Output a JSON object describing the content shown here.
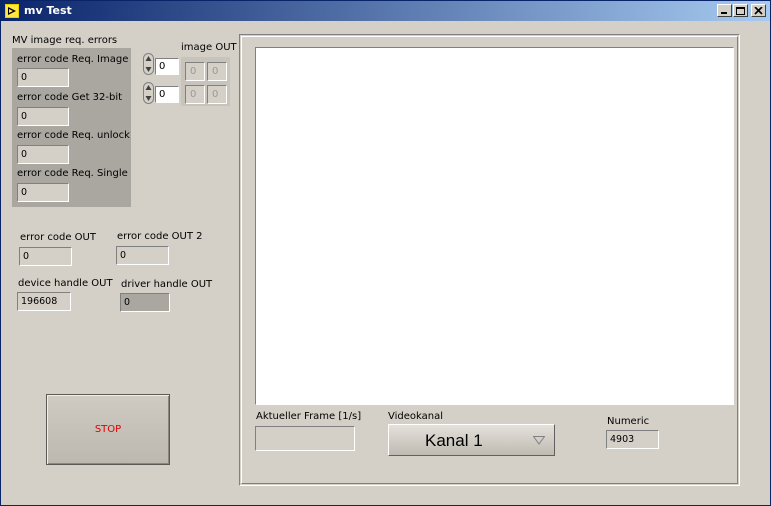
{
  "window": {
    "title": "mv Test",
    "controls": [
      "minimize-icon",
      "maximize-icon",
      "close-icon"
    ]
  },
  "errors_cluster": {
    "title": "MV image req. errors",
    "items": [
      {
        "label": "error code Req. Image",
        "value": "0"
      },
      {
        "label": "error code Get 32-bit",
        "value": "0"
      },
      {
        "label": "error code Req. unlock",
        "value": "0"
      },
      {
        "label": "error code Req. Single",
        "value": "0"
      }
    ]
  },
  "index": {
    "row_index": "0",
    "col_index": "0"
  },
  "image_out": {
    "label": "image OUT",
    "cells": [
      "0",
      "0",
      "0",
      "0"
    ]
  },
  "error_code_out": {
    "label": "error code OUT",
    "value": "0"
  },
  "error_code_out2": {
    "label": "error code OUT 2",
    "value": "0"
  },
  "device_handle_out": {
    "label": "device handle OUT",
    "value": "196608"
  },
  "driver_handle_out": {
    "label": "driver handle OUT",
    "value": "0"
  },
  "stop_button": {
    "label": "STOP",
    "color": "#e00000"
  },
  "frame_rate": {
    "label": "Aktueller Frame [1/s]",
    "value": ""
  },
  "videokanal": {
    "label": "Videokanal",
    "selected": "Kanal 1"
  },
  "numeric": {
    "label": "Numeric",
    "value": "4903"
  },
  "colors": {
    "titlebar_start": "#0a246a",
    "titlebar_end": "#a6caf0",
    "panel": "#d4d0c8"
  }
}
